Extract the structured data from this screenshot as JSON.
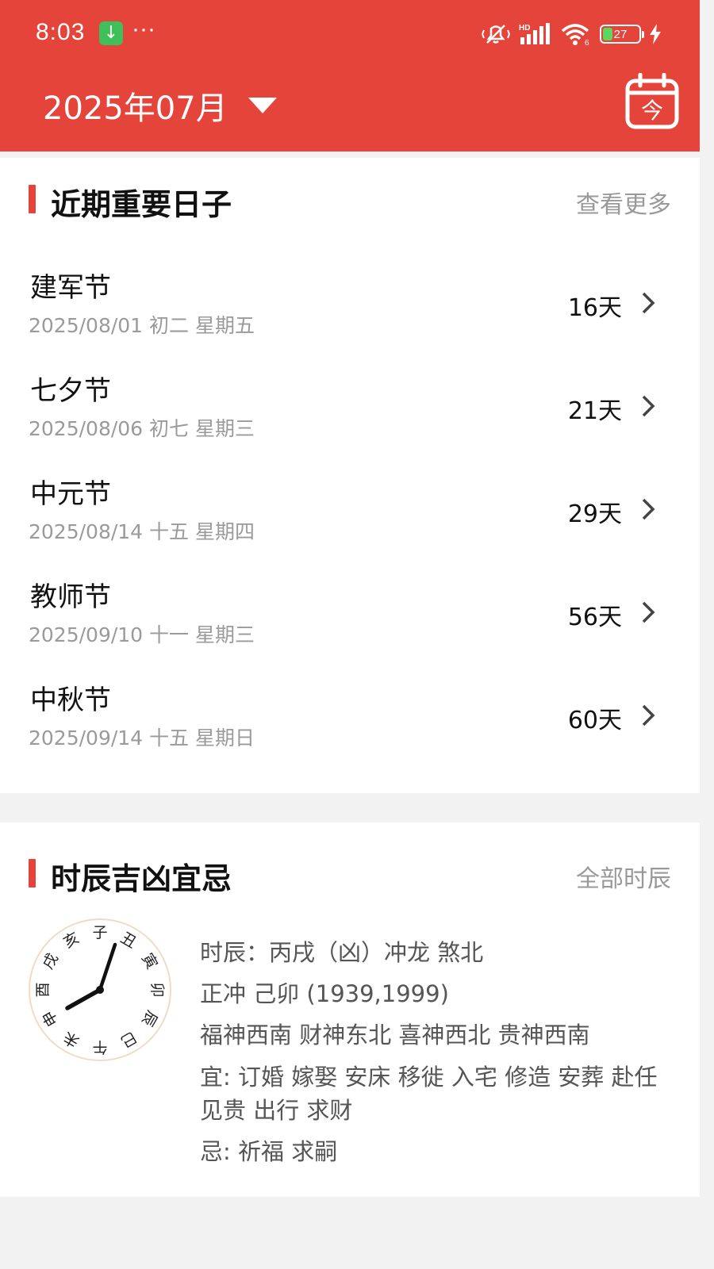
{
  "status": {
    "time": "8:03",
    "dots": "···",
    "hd": "HD",
    "battery": "27"
  },
  "header": {
    "month": "2025年07月",
    "today_label": "今"
  },
  "important_days": {
    "title": "近期重要日子",
    "more": "查看更多",
    "items": [
      {
        "name": "建军节",
        "date": "2025/08/01 初二 星期五",
        "days": "16天"
      },
      {
        "name": "七夕节",
        "date": "2025/08/06 初七 星期三",
        "days": "21天"
      },
      {
        "name": "中元节",
        "date": "2025/08/14 十五 星期四",
        "days": "29天"
      },
      {
        "name": "教师节",
        "date": "2025/09/10 十一 星期三",
        "days": "56天"
      },
      {
        "name": "中秋节",
        "date": "2025/09/14 十五 星期日",
        "days": "60天"
      }
    ]
  },
  "hours": {
    "title": "时辰吉凶宜忌",
    "more": "全部时辰",
    "clock_chars": [
      "子",
      "丑",
      "寅",
      "卯",
      "辰",
      "巳",
      "午",
      "未",
      "申",
      "酉",
      "戌",
      "亥"
    ],
    "line1": "时辰：丙戌（凶）冲龙 煞北",
    "line2": "正冲 己卯 (1939,1999)",
    "line3": "福神西南 财神东北 喜神西北 贵神西南",
    "yi": "宜: 订婚 嫁娶 安床 移徙 入宅 修造 安葬 赴任 见贵 出行 求财",
    "ji": "忌: 祈福 求嗣"
  },
  "colors": {
    "brand": "#e4443a",
    "battery_fill": "#5cd65c",
    "download_badge": "#3fbf59"
  }
}
